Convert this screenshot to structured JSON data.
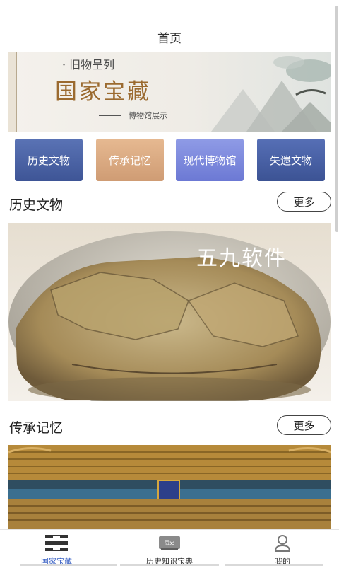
{
  "header": {
    "title": "首页"
  },
  "banner": {
    "tag": "· 旧物呈列",
    "title": "国家宝藏",
    "subtitle": "博物馆展示"
  },
  "categories": [
    {
      "label": "历史文物",
      "color": "#4a63a6"
    },
    {
      "label": "传承记忆",
      "color": "#dcae86"
    },
    {
      "label": "现代博物馆",
      "color": "#7f8be0"
    },
    {
      "label": "失遗文物",
      "color": "#4a62a4"
    }
  ],
  "sections": [
    {
      "title": "历史文物",
      "more": "更多",
      "image_watermark": "五九软件"
    },
    {
      "title": "传承记忆",
      "more": "更多"
    }
  ],
  "tabbar": {
    "items": [
      {
        "label": "国家宝藏",
        "icon": "grid-icon",
        "active": true
      },
      {
        "label": "历史知识宝典",
        "icon": "book-icon",
        "active": false
      },
      {
        "label": "我的",
        "icon": "user-icon",
        "active": false
      }
    ],
    "book_icon_text": "历史"
  },
  "colors": {
    "accent": "#3b62c4"
  }
}
